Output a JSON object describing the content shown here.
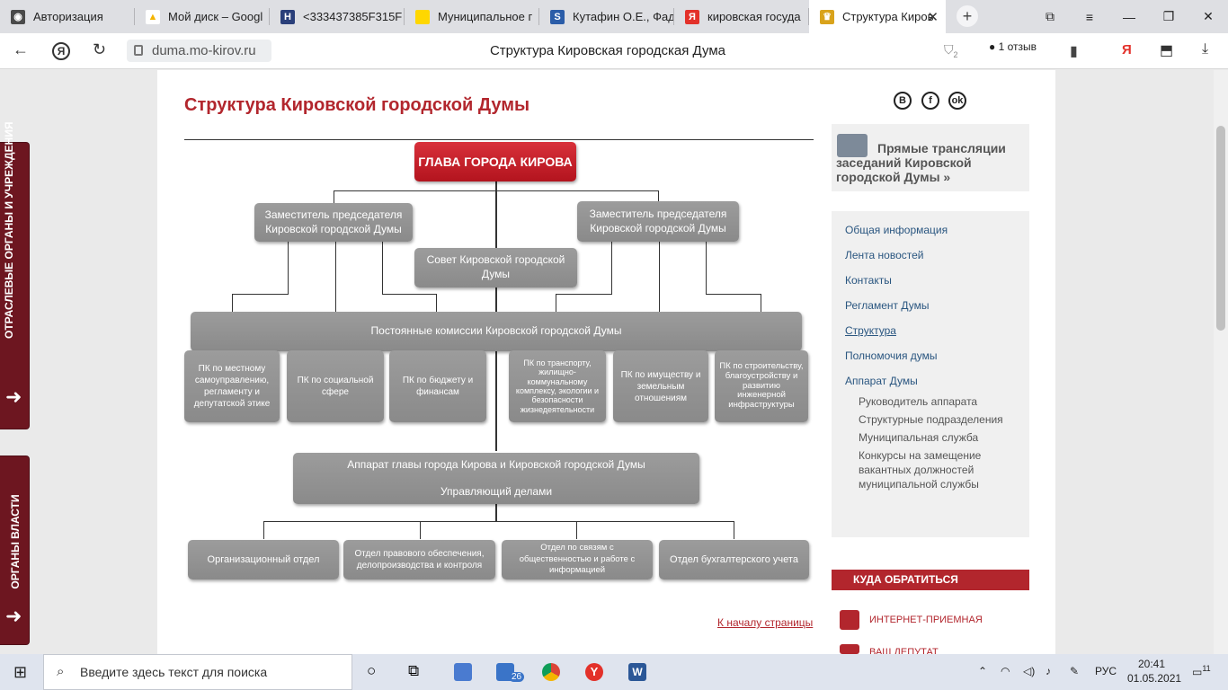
{
  "browser": {
    "tabs": [
      {
        "label": "Авторизация",
        "color": "#4a4a4a",
        "glyph": "◉"
      },
      {
        "label": "Мой диск – Googl",
        "color": "#f4b400",
        "glyph": "▲"
      },
      {
        "label": "<333437385F315F",
        "color": "#2a3f7a",
        "glyph": "H"
      },
      {
        "label": "Муниципальное г",
        "color": "#ffd700",
        "glyph": ""
      },
      {
        "label": "Кутафин О.Е., Фад",
        "color": "#2b5da8",
        "glyph": "S"
      },
      {
        "label": "кировская госуда",
        "color": "#e3312a",
        "glyph": "Я"
      },
      {
        "label": "Структура Киров",
        "color": "#d9a31c",
        "glyph": "♛"
      }
    ],
    "url": "duma.mo-kirov.ru",
    "page_title": "Структура Кировская городская Дума",
    "review_count": "1 отзыв",
    "badge_count": "2"
  },
  "side_tabs": {
    "top": "ОТРАСЛЕВЫЕ ОРГАНЫ И УЧРЕЖДЕНИЯ",
    "bottom": "ОРГАНЫ ВЛАСТИ"
  },
  "heading": "Структура Кировской городской Думы",
  "org": {
    "head": "ГЛАВА ГОРОДА КИРОВА",
    "deputy_left": "Заместитель председателя Кировской городской Думы",
    "deputy_right": "Заместитель председателя Кировской городской Думы",
    "council": "Совет Кировской городской Думы",
    "commissions": "Постоянные комиссии Кировской городской Думы",
    "pk": [
      "ПК по местному самоуправлению, регламенту и депутатской этике",
      "ПК по социальной сфере",
      "ПК по бюджету и финансам",
      "ПК по транспорту, жилищно-коммунальному комплексу, экологии и безопасности жизнедеятельности",
      "ПК по имуществу и земельным отношениям",
      "ПК по строительству, благоустройству и развитию инженерной инфраструктуры"
    ],
    "apparatus": "Аппарат главы города Кирова и Кировской городской Думы",
    "manager": "Управляющий делами",
    "departments": [
      "Организационный отдел",
      "Отдел правового обеспечения, делопроизводства и контроля",
      "Отдел по связям с общественностью и работе с информацией",
      "Отдел бухгалтерского учета"
    ]
  },
  "back_to_top": "К началу страницы",
  "promo": "Прямые трансляции заседаний Кировской городской Думы »",
  "menu": {
    "items": [
      "Общая информация",
      "Лента новостей",
      "Контакты",
      "Регламент Думы",
      "Структура",
      "Полномочия думы",
      "Аппарат Думы"
    ],
    "sub": [
      "Руководитель аппарата",
      "Структурные подразделения",
      "Муниципальная служба",
      "Конкурсы на замещение вакантных должностей муниципальной службы"
    ]
  },
  "cta": "КУДА ОБРАТИТЬСЯ",
  "links": [
    "ИНТЕРНЕТ-ПРИЕМНАЯ",
    "ВАШ ДЕПУТАТ"
  ],
  "taskbar": {
    "search_placeholder": "Введите здесь текст для поиска",
    "mail_badge": "26",
    "lang": "РУС",
    "time": "20:41",
    "date": "01.05.2021",
    "notif": "11"
  }
}
